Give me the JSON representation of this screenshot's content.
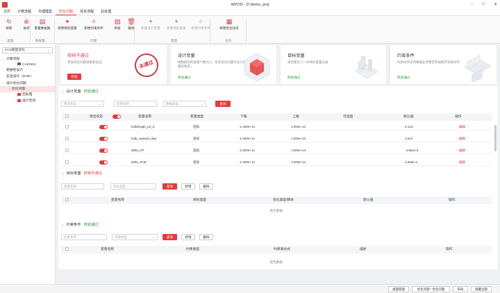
{
  "window": {
    "title": "AIPOD - D:\\demo_proj",
    "min": "−",
    "max": "□",
    "close": "✕"
  },
  "menu": [
    "文件",
    "计算流程",
    "代理模型",
    "优化问题",
    "任务流程",
    "后处理"
  ],
  "menu_active": 3,
  "ribbon": {
    "buttons": [
      {
        "label": "刷新",
        "icon": "↻"
      },
      {
        "label": "关闭",
        "icon": "⊗"
      },
      {
        "label": "重置数据集",
        "icon": "▤"
      },
      {
        "label": "新建目标变量",
        "icon": "✦"
      },
      {
        "label": "新建约束条件",
        "icon": "✧"
      },
      {
        "label": "校核",
        "icon": "▧"
      },
      {
        "label": "删除",
        "icon": "🗑"
      },
      {
        "label": "新建设计变量",
        "icon": "✦"
      },
      {
        "label": "新建目标变量",
        "icon": "✦"
      },
      {
        "label": "新建约束条件",
        "icon": "✧"
      },
      {
        "label": "新建优化任务",
        "icon": "▦"
      }
    ],
    "groups": [
      "桌面",
      "数据集",
      "问题",
      "变量",
      "任务"
    ]
  },
  "left": {
    "dropdown": "KCS船型优化",
    "tree": [
      {
        "label": "计算流程",
        "indent": 0,
        "exp": "⌄",
        "icon": ""
      },
      {
        "label": "CAESES",
        "indent": 2,
        "exp": "",
        "icon": "blue"
      },
      {
        "label": "稳健性设计",
        "indent": 0,
        "exp": "",
        "icon": ""
      },
      {
        "label": "实验设计（DOE）",
        "indent": 0,
        "exp": "",
        "icon": ""
      },
      {
        "label": "设计优化问题",
        "indent": 0,
        "exp": "⌄",
        "icon": ""
      },
      {
        "label": "优化问题",
        "indent": 1,
        "exp": "⌄",
        "icon": "",
        "sel": true
      },
      {
        "label": "后处理",
        "indent": 2,
        "exp": "",
        "icon": "red"
      },
      {
        "label": "设计空间",
        "indent": 2,
        "exp": "",
        "icon": "red"
      }
    ]
  },
  "cards": [
    {
      "title": "校核不通过",
      "desc": "无效优化问题请重新验证",
      "btn": "校核",
      "stamp": "未通过"
    },
    {
      "title": "设计变量",
      "desc": "跟数据流的变量个数为 4，符合优化问题对设计变量的要求。",
      "status": "校验通过"
    },
    {
      "title": "目标变量",
      "desc": "请创建至少一条目标变量记录",
      "status": "校验通过"
    },
    {
      "title": "约束条件",
      "desc": "约束条件支持根据业务需求添加或不添加均可",
      "status": "校验通过"
    }
  ],
  "design_vars": {
    "title": "设计变量",
    "status": "校验通过",
    "filters": {
      "f1": "激活状态",
      "f2": "变量名称",
      "f3": "数据类型",
      "query": "查询"
    },
    "headers": [
      "激活状态",
      "变量名称",
      "变量类型",
      "下限",
      "上限",
      "可选值",
      "默认值",
      "操作"
    ],
    "rows": [
      {
        "name": "bulblength_p2_Z",
        "type": "连续",
        "lower": "-1.000e+14",
        "upper": "1.000e+14",
        "opts": "",
        "def": "0.123",
        "op": "编辑"
      },
      {
        "name": "bulb_upward_deg",
        "type": "连续",
        "lower": "-1.000e+14",
        "upper": "1.000e+14",
        "opts": "",
        "def": "4.544",
        "op": "编辑"
      },
      {
        "name": "delta_CP",
        "type": "连续",
        "lower": "-1.000e+14",
        "upper": "1.000e+14",
        "opts": "",
        "def": "-4.551e-3",
        "op": "编辑"
      },
      {
        "name": "delta_XCB",
        "type": "连续",
        "lower": "-1.000e+14",
        "upper": "1.000e+14",
        "opts": "",
        "def": "1.655e-3",
        "op": "编辑"
      }
    ]
  },
  "target_vars": {
    "title": "目标变量",
    "status": "校核不通过",
    "filters": {
      "f1": "变量名称",
      "f2": "优化类型",
      "query": "查询",
      "add": "新增",
      "del": "删除"
    },
    "headers": [
      "变量名称",
      "目标类型",
      "优化类型/脚本",
      "默认值",
      "操作"
    ],
    "empty": "暂无数据"
  },
  "constraints": {
    "title": "约束条件",
    "status": "校验通过",
    "filters": {
      "f1": "约束条件",
      "f2": "约束类型",
      "query": "查询",
      "add": "新增",
      "del": "删除"
    },
    "headers": [
      "变量名称",
      "约束类型",
      "约束表达式",
      "描述",
      "操作"
    ],
    "empty": "暂无数据"
  },
  "statusbar": {
    "b1": "桌面管理",
    "b2": "优化问题 / 优化问题",
    "b3": "布局",
    "b4": "隐藏全部"
  },
  "colors": {
    "accent": "#e23b3b",
    "ok": "#1e9a3c"
  }
}
